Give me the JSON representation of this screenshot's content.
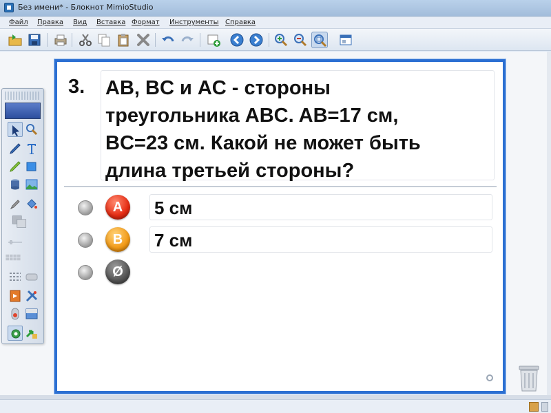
{
  "window": {
    "title": "Без имени* - Блокнот MimioStudio"
  },
  "menu": {
    "items": [
      "Файл",
      "Правка",
      "Вид",
      "Вставка",
      "Формат",
      "Инструменты",
      "Справка"
    ]
  },
  "toolbar": {
    "buttons": [
      "open-icon",
      "save-icon",
      "print-icon",
      "cut-icon",
      "copy-icon",
      "paste-icon",
      "delete-icon",
      "undo-icon",
      "redo-icon",
      "new-page-icon",
      "previous-page-icon",
      "next-page-icon",
      "zoom-in-icon",
      "zoom-out-icon",
      "zoom-fit-icon",
      "view-icon"
    ]
  },
  "question": {
    "number": "3.",
    "lines": [
      "AB, BC и AC - стороны",
      "треугольника ABC. AB=17 см,",
      "BC=23 см. Какой не может быть",
      "длина третьей стороны?"
    ]
  },
  "answers": [
    {
      "badge": "A",
      "text": "5 см",
      "color": "#e52b12"
    },
    {
      "badge": "B",
      "text": "7 см",
      "color": "#f29a16"
    },
    {
      "badge": "Ø",
      "text": "",
      "color": "#555555"
    }
  ],
  "colors": {
    "page_border": "#2b6fd2",
    "accent": "#2a6fb5"
  }
}
